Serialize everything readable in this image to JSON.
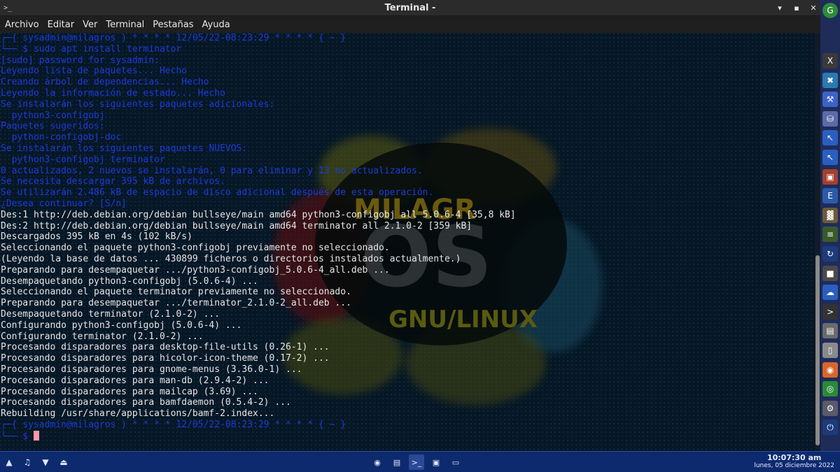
{
  "window": {
    "title": "Terminal -",
    "app_icon": ">_",
    "controls": [
      "▾",
      "▪",
      "✕"
    ]
  },
  "menu": [
    "Archivo",
    "Editar",
    "Ver",
    "Terminal",
    "Pestañas",
    "Ayuda"
  ],
  "logo": {
    "word1": "MILAGR",
    "word2": "OS",
    "word3": "GNU/LINUX"
  },
  "terminal": {
    "lines": [
      {
        "cls": "c-blue",
        "text": "┌─{ sysadmin@milagros ) * * * * 12/05/22-08:23:29 * * * * { ~ }"
      },
      {
        "cls": "c-blue",
        "text": "└── $ sudo apt install terminator"
      },
      {
        "cls": "c-blue",
        "text": "[sudo] password for sysadmin:"
      },
      {
        "cls": "c-blue",
        "text": "Leyendo lista de paquetes... Hecho"
      },
      {
        "cls": "c-blue",
        "text": "Creando árbol de dependencias... Hecho"
      },
      {
        "cls": "c-blue",
        "text": "Leyendo la información de estado... Hecho"
      },
      {
        "cls": "c-blue",
        "text": "Se instalarán los siguientes paquetes adicionales:"
      },
      {
        "cls": "c-blue",
        "text": "  python3-configobj"
      },
      {
        "cls": "c-blue",
        "text": "Paquetes sugeridos:"
      },
      {
        "cls": "c-blue",
        "text": "  python-configobj-doc"
      },
      {
        "cls": "c-blue",
        "text": "Se instalarán los siguientes paquetes NUEVOS:"
      },
      {
        "cls": "c-blue",
        "text": "  python3-configobj terminator"
      },
      {
        "cls": "c-blue",
        "text": "0 actualizados, 2 nuevos se instalarán, 0 para eliminar y 13 no actualizados."
      },
      {
        "cls": "c-blue",
        "text": "Se necesita descargar 395 kB de archivos."
      },
      {
        "cls": "c-blue",
        "text": "Se utilizarán 2.486 kB de espacio de disco adicional después de esta operación."
      },
      {
        "cls": "c-blue",
        "text": "¿Desea continuar? [S/n]"
      },
      {
        "cls": "c-white",
        "text": "Des:1 http://deb.debian.org/debian bullseye/main amd64 python3-configobj all 5.0.6-4 [35,8 kB]"
      },
      {
        "cls": "c-white",
        "text": "Des:2 http://deb.debian.org/debian bullseye/main amd64 terminator all 2.1.0-2 [359 kB]"
      },
      {
        "cls": "c-white",
        "text": "Descargados 395 kB en 4s (102 kB/s)"
      },
      {
        "cls": "c-white",
        "text": "Seleccionando el paquete python3-configobj previamente no seleccionado."
      },
      {
        "cls": "c-white",
        "text": "(Leyendo la base de datos ... 430899 ficheros o directorios instalados actualmente.)"
      },
      {
        "cls": "c-white",
        "text": "Preparando para desempaquetar .../python3-configobj_5.0.6-4_all.deb ..."
      },
      {
        "cls": "c-white",
        "text": "Desempaquetando python3-configobj (5.0.6-4) ..."
      },
      {
        "cls": "c-white",
        "text": "Seleccionando el paquete terminator previamente no seleccionado."
      },
      {
        "cls": "c-white",
        "text": "Preparando para desempaquetar .../terminator_2.1.0-2_all.deb ..."
      },
      {
        "cls": "c-white",
        "text": "Desempaquetando terminator (2.1.0-2) ..."
      },
      {
        "cls": "c-white",
        "text": "Configurando python3-configobj (5.0.6-4) ..."
      },
      {
        "cls": "c-white",
        "text": "Configurando terminator (2.1.0-2) ..."
      },
      {
        "cls": "c-white",
        "text": "Procesando disparadores para desktop-file-utils (0.26-1) ..."
      },
      {
        "cls": "c-white",
        "text": "Procesando disparadores para hicolor-icon-theme (0.17-2) ..."
      },
      {
        "cls": "c-white",
        "text": "Procesando disparadores para gnome-menus (3.36.0-1) ..."
      },
      {
        "cls": "c-white",
        "text": "Procesando disparadores para man-db (2.9.4-2) ..."
      },
      {
        "cls": "c-white",
        "text": "Procesando disparadores para mailcap (3.69) ..."
      },
      {
        "cls": "c-white",
        "text": "Procesando disparadores para bamfdaemon (0.5.4-2) ..."
      },
      {
        "cls": "c-white",
        "text": "Rebuilding /usr/share/applications/bamf-2.index..."
      },
      {
        "cls": "c-blue",
        "text": "┌─{ sysadmin@milagros ) * * * * 12/05/22-08:23:29 * * * * { ~ }"
      },
      {
        "cls": "c-blue",
        "text": "└── $ ",
        "cursor": true
      }
    ]
  },
  "dock": [
    {
      "name": "x-terminal-icon",
      "glyph": "X",
      "color": "#3a3a3a"
    },
    {
      "name": "grid-tool-icon",
      "glyph": "✖",
      "color": "#2a7ab0"
    },
    {
      "name": "settings-tool-icon",
      "glyph": "⚒",
      "color": "#3b63c7"
    },
    {
      "name": "disk-utility-icon",
      "glyph": "⛁",
      "color": "#5c6aa8"
    },
    {
      "name": "pointer-tool-icon",
      "glyph": "↖",
      "color": "#2a5fc0"
    },
    {
      "name": "pointer-tool-alt-icon",
      "glyph": "↖",
      "color": "#2a5fc0"
    },
    {
      "name": "package-icon",
      "glyph": "▣",
      "color": "#a5402e"
    },
    {
      "name": "text-editor-icon",
      "glyph": "E",
      "color": "#2d5aa8"
    },
    {
      "name": "chart-monitor-icon",
      "glyph": "▓",
      "color": "#6b5a3a"
    },
    {
      "name": "calculator-icon",
      "glyph": "≡",
      "color": "#3a5a2a"
    },
    {
      "name": "sync-icon",
      "glyph": "↻",
      "color": "#1d3a7a"
    },
    {
      "name": "screen-capture-icon",
      "glyph": "■",
      "color": "#4a4a4a"
    },
    {
      "name": "cloud-icon",
      "glyph": "☁",
      "color": "#2a5fc0"
    },
    {
      "name": "terminal-icon",
      "glyph": ">",
      "color": "#333333"
    },
    {
      "name": "file-manager-icon",
      "glyph": "▤",
      "color": "#6a6a6a"
    },
    {
      "name": "document-icon",
      "glyph": "▯",
      "color": "#8a8a8a"
    },
    {
      "name": "firefox-icon",
      "glyph": "◉",
      "color": "#d9662a"
    },
    {
      "name": "chrome-icon",
      "glyph": "◎",
      "color": "#2a8a3a"
    },
    {
      "name": "network-settings-icon",
      "glyph": "⚙",
      "color": "#5a5a6a"
    },
    {
      "name": "power-icon",
      "glyph": "⏻",
      "color": "#1d3a7a"
    }
  ],
  "panel": {
    "left_icons": [
      {
        "name": "notifications-icon",
        "glyph": "▲"
      },
      {
        "name": "volume-icon",
        "glyph": "♫"
      },
      {
        "name": "network-icon",
        "glyph": "▼"
      },
      {
        "name": "eject-icon",
        "glyph": "⏏"
      }
    ],
    "tasks": [
      {
        "name": "task-firefox",
        "glyph": "◉",
        "active": false
      },
      {
        "name": "task-document",
        "glyph": "▤",
        "active": false
      },
      {
        "name": "task-terminal",
        "glyph": ">_",
        "active": true
      },
      {
        "name": "task-image-viewer",
        "glyph": "▣",
        "active": false
      },
      {
        "name": "task-monitor",
        "glyph": "▭",
        "active": false
      }
    ],
    "clock": {
      "time": "10:07:30 am",
      "date": "lunes, 05 diciembre 2022"
    }
  }
}
